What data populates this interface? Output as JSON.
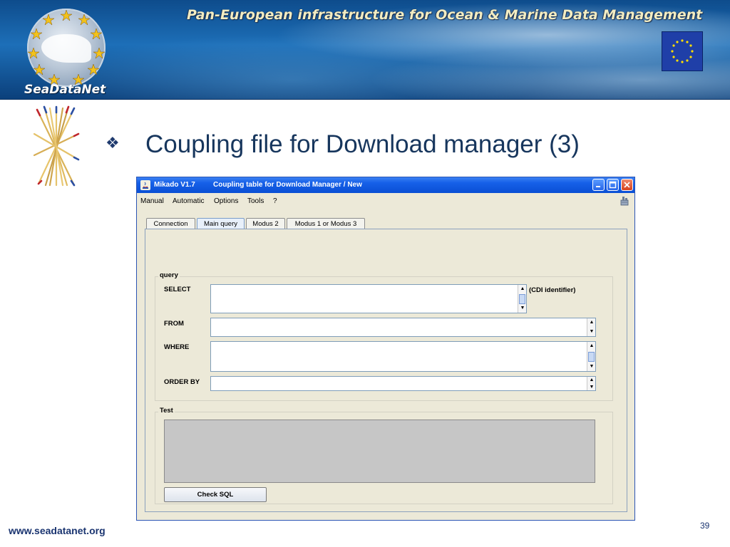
{
  "header": {
    "banner_title": "Pan-European infrastructure for Ocean & Marine Data Management",
    "logo_text": "SeaDataNet"
  },
  "slide": {
    "title": "Coupling file for Download manager (3)",
    "bullet": "❖"
  },
  "window": {
    "app_name": "Mikado V1.7",
    "window_title": "Coupling table for Download Manager / New",
    "menu": [
      "Manual",
      "Automatic",
      "Options",
      "Tools",
      "?"
    ],
    "tabs": [
      {
        "label": "Connection",
        "active": false
      },
      {
        "label": "Main query",
        "active": true
      },
      {
        "label": "Modus 2",
        "active": false
      },
      {
        "label": "Modus 1 or Modus 3",
        "active": false
      }
    ],
    "query_group": {
      "legend": "query",
      "select_label": "SELECT",
      "select_hint": "(CDI identifier)",
      "from_label": "FROM",
      "where_label": "WHERE",
      "order_by_label": "ORDER BY",
      "select_value": "",
      "from_value": "",
      "where_value": "",
      "order_by_value": ""
    },
    "test_group": {
      "legend": "Test",
      "check_sql_label": "Check SQL"
    }
  },
  "footer": {
    "url": "www.seadatanet.org",
    "page_number": "39"
  },
  "colors": {
    "title_blue": "#17365d",
    "titlebar_blue": "#0a4fd4",
    "footer_blue": "#1a3470"
  }
}
